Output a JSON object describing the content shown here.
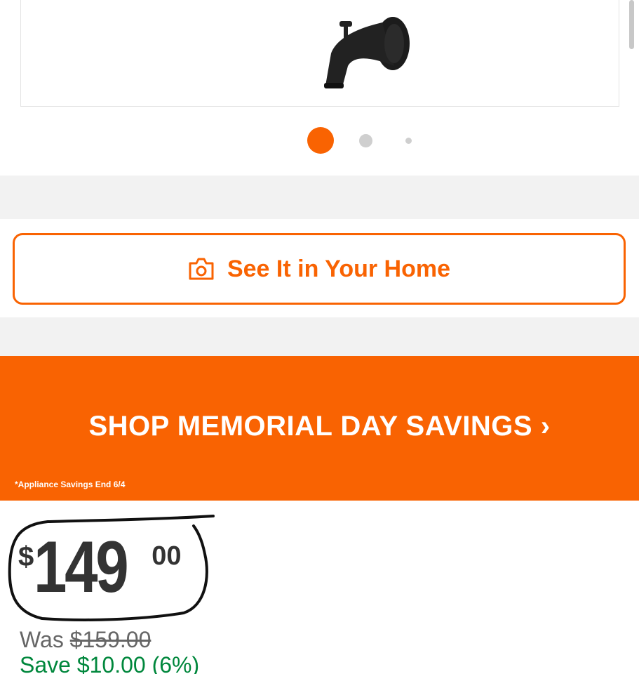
{
  "carousel": {
    "image_alt": "Matte black tub spout",
    "dot_count": 3,
    "active_dot": 1,
    "colors": {
      "active": "#f96302",
      "inactive": "#cfcfcf"
    }
  },
  "ar_button": {
    "label": "See It in Your Home",
    "icon": "camera-icon"
  },
  "promo_banner": {
    "headline": "SHOP MEMORIAL DAY SAVINGS ›",
    "fine_print": "*Appliance Savings End 6/4",
    "background": "#f96302"
  },
  "pricing": {
    "currency_symbol": "$",
    "dollars": "149",
    "cents": "00",
    "was_label": "Was",
    "was_price": "$159.00",
    "savings_text": "Save $10.00 (6%)",
    "savings_color": "#00873c"
  }
}
